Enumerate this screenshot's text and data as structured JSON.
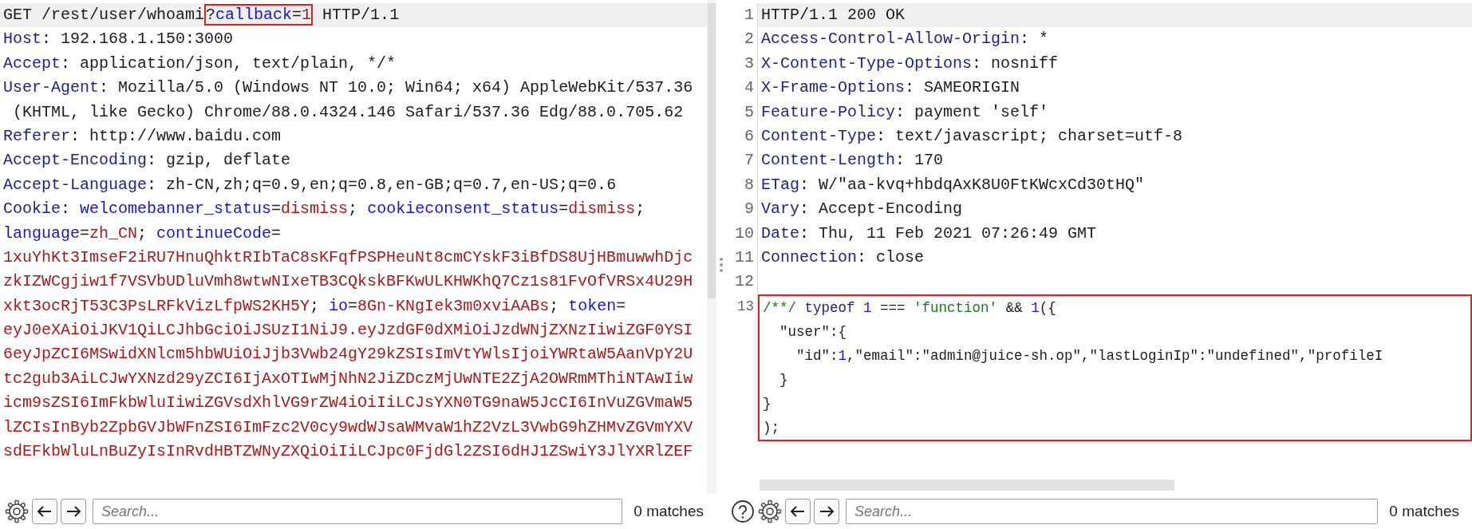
{
  "request": {
    "lines": [
      {
        "current": true,
        "segments": [
          {
            "text": "GET /rest/user/whoami",
            "kind": "plain"
          }
        ],
        "box": [
          {
            "text": "?",
            "kind": "plain"
          },
          {
            "text": "callback",
            "kind": "param"
          },
          {
            "text": "=",
            "kind": "plain"
          },
          {
            "text": "1",
            "kind": "value"
          }
        ],
        "after": [
          {
            "text": " HTTP/1.1",
            "kind": "plain"
          }
        ]
      },
      {
        "current": false,
        "segments": [
          {
            "text": "Host",
            "kind": "key"
          },
          {
            "text": ": 192.168.1.150:3000",
            "kind": "plain"
          }
        ]
      },
      {
        "current": false,
        "segments": [
          {
            "text": "Accept",
            "kind": "key"
          },
          {
            "text": ": application/json, text/plain, */*",
            "kind": "plain"
          }
        ]
      },
      {
        "current": false,
        "segments": [
          {
            "text": "User-Agent",
            "kind": "key"
          },
          {
            "text": ": Mozilla/5.0 (Windows NT 10.0; Win64; x64) AppleWebKit/537.36",
            "kind": "plain"
          }
        ]
      },
      {
        "current": false,
        "segments": [
          {
            "text": " (KHTML, like Gecko) Chrome/88.0.4324.146 Safari/537.36 Edg/88.0.705.62",
            "kind": "plain"
          }
        ]
      },
      {
        "current": false,
        "segments": [
          {
            "text": "Referer",
            "kind": "key"
          },
          {
            "text": ": http://www.baidu.com",
            "kind": "plain"
          }
        ]
      },
      {
        "current": false,
        "segments": [
          {
            "text": "Accept-Encoding",
            "kind": "key"
          },
          {
            "text": ": gzip, deflate",
            "kind": "plain"
          }
        ]
      },
      {
        "current": false,
        "segments": [
          {
            "text": "Accept-Language",
            "kind": "key"
          },
          {
            "text": ": zh-CN,zh;q=0.9,en;q=0.8,en-GB;q=0.7,en-US;q=0.6",
            "kind": "plain"
          }
        ]
      },
      {
        "current": false,
        "segments": [
          {
            "text": "Cookie",
            "kind": "key"
          },
          {
            "text": ": ",
            "kind": "plain"
          },
          {
            "text": "welcomebanner_status",
            "kind": "param"
          },
          {
            "text": "=",
            "kind": "plain"
          },
          {
            "text": "dismiss",
            "kind": "value"
          },
          {
            "text": "; ",
            "kind": "plain"
          },
          {
            "text": "cookieconsent_status",
            "kind": "param"
          },
          {
            "text": "=",
            "kind": "plain"
          },
          {
            "text": "dismiss",
            "kind": "value"
          },
          {
            "text": ";",
            "kind": "plain"
          }
        ]
      },
      {
        "current": false,
        "segments": [
          {
            "text": "language",
            "kind": "param"
          },
          {
            "text": "=",
            "kind": "plain"
          },
          {
            "text": "zh_CN",
            "kind": "value"
          },
          {
            "text": "; ",
            "kind": "plain"
          },
          {
            "text": "continueCode",
            "kind": "param"
          },
          {
            "text": "=",
            "kind": "plain"
          }
        ]
      },
      {
        "current": false,
        "segments": [
          {
            "text": "1xuYhKt3ImseF2iRU7HnuQhktRIbTaC8sKFqfPSPHeuNt8cmCYskF3iBfDS8UjHBmuwwhDjc",
            "kind": "value"
          }
        ]
      },
      {
        "current": false,
        "segments": [
          {
            "text": "zkIZWCgjiw1f7VSVbUDluVmh8wtwNIxeTB3CQkskBFKwULKHWKhQ7Cz1s81FvOfVRSx4U29H",
            "kind": "value"
          }
        ]
      },
      {
        "current": false,
        "segments": [
          {
            "text": "xkt3ocRjT53C3PsLRFkVizLfpWS2KH5Y",
            "kind": "value"
          },
          {
            "text": "; ",
            "kind": "plain"
          },
          {
            "text": "io",
            "kind": "param"
          },
          {
            "text": "=",
            "kind": "plain"
          },
          {
            "text": "8Gn-KNgIek3m0xviAABs",
            "kind": "value"
          },
          {
            "text": "; ",
            "kind": "plain"
          },
          {
            "text": "token",
            "kind": "param"
          },
          {
            "text": "=",
            "kind": "plain"
          }
        ]
      },
      {
        "current": false,
        "segments": [
          {
            "text": "eyJ0eXAiOiJKV1QiLCJhbGciOiJSUzI1NiJ9.eyJzdGF0dXMiOiJzdWNjZXNzIiwiZGF0YSI",
            "kind": "value"
          }
        ]
      },
      {
        "current": false,
        "segments": [
          {
            "text": "6eyJpZCI6MSwidXNlcm5hbWUiOiJjb3Vwb24gY29kZSIsImVtYWlsIjoiYWRtaW5AanVpY2U",
            "kind": "value"
          }
        ]
      },
      {
        "current": false,
        "segments": [
          {
            "text": "tc2gub3AiLCJwYXNzd29yZCI6IjAxOTIwMjNhN2JiZDczMjUwNTE2ZjA2OWRmMThiNTAwIiw",
            "kind": "value"
          }
        ]
      },
      {
        "current": false,
        "segments": [
          {
            "text": "icm9sZSI6ImFkbWluIiwiZGVsdXhlVG9rZW4iOiIiLCJsYXN0TG9naW5JcCI6InVuZGVmaW5",
            "kind": "value"
          }
        ]
      },
      {
        "current": false,
        "segments": [
          {
            "text": "lZCIsInByb2ZpbGVJbWFnZSI6ImFzc2V0cy9wdWJsaWMvaW1hZ2VzL3VwbG9hZHMvZGVmYXV",
            "kind": "value"
          }
        ]
      },
      {
        "current": false,
        "segments": [
          {
            "text": "sdEFkbWluLnBuZyIsInRvdHBTZWNyZXQiOiIiLCJpc0FjdGl2ZSI6dHJ1ZSwiY3JlYXRlZEF",
            "kind": "value"
          }
        ]
      }
    ],
    "footer": {
      "help_button": false,
      "search": {
        "placeholder": "Search..."
      },
      "matches": "0 matches"
    }
  },
  "response": {
    "lines": [
      {
        "number": "1",
        "current": true,
        "segments": [
          {
            "text": "HTTP/1.1 200 OK",
            "kind": "plain"
          }
        ]
      },
      {
        "number": "2",
        "current": false,
        "segments": [
          {
            "text": "Access-Control-Allow-Origin",
            "kind": "key"
          },
          {
            "text": ": *",
            "kind": "plain"
          }
        ]
      },
      {
        "number": "3",
        "current": false,
        "segments": [
          {
            "text": "X-Content-Type-Options",
            "kind": "key"
          },
          {
            "text": ": nosniff",
            "kind": "plain"
          }
        ]
      },
      {
        "number": "4",
        "current": false,
        "segments": [
          {
            "text": "X-Frame-Options",
            "kind": "key"
          },
          {
            "text": ": SAMEORIGIN",
            "kind": "plain"
          }
        ]
      },
      {
        "number": "5",
        "current": false,
        "segments": [
          {
            "text": "Feature-Policy",
            "kind": "key"
          },
          {
            "text": ": payment 'self'",
            "kind": "plain"
          }
        ]
      },
      {
        "number": "6",
        "current": false,
        "segments": [
          {
            "text": "Content-Type",
            "kind": "key"
          },
          {
            "text": ": text/javascript; charset=utf-8",
            "kind": "plain"
          }
        ]
      },
      {
        "number": "7",
        "current": false,
        "segments": [
          {
            "text": "Content-Length",
            "kind": "key"
          },
          {
            "text": ": 170",
            "kind": "plain"
          }
        ]
      },
      {
        "number": "8",
        "current": false,
        "segments": [
          {
            "text": "ETag",
            "kind": "key"
          },
          {
            "text": ": W/\"aa-kvq+hbdqAxK8U0FtKWcxCd30tHQ\"",
            "kind": "plain"
          }
        ]
      },
      {
        "number": "9",
        "current": false,
        "segments": [
          {
            "text": "Vary",
            "kind": "key"
          },
          {
            "text": ": Accept-Encoding",
            "kind": "plain"
          }
        ]
      },
      {
        "number": "10",
        "current": false,
        "segments": [
          {
            "text": "Date",
            "kind": "key"
          },
          {
            "text": ": Thu, 11 Feb 2021 07:26:49 GMT",
            "kind": "plain"
          }
        ]
      },
      {
        "number": "11",
        "current": false,
        "segments": [
          {
            "text": "Connection",
            "kind": "key"
          },
          {
            "text": ": close",
            "kind": "plain"
          }
        ]
      },
      {
        "number": "12",
        "current": false
      }
    ],
    "boxed_line": {
      "number": "13",
      "rows": [
        [
          {
            "text": "/**/",
            "kind": "comment"
          },
          {
            "text": " ",
            "kind": "plain"
          },
          {
            "text": "typeof",
            "kind": "keyword"
          },
          {
            "text": " ",
            "kind": "plain"
          },
          {
            "text": "1",
            "kind": "number"
          },
          {
            "text": " === ",
            "kind": "plain"
          },
          {
            "text": "'function'",
            "kind": "string"
          },
          {
            "text": " && ",
            "kind": "plain"
          },
          {
            "text": "1",
            "kind": "number"
          },
          {
            "text": "({",
            "kind": "plain"
          }
        ],
        [
          {
            "text": "  \"user\":{",
            "kind": "plain"
          }
        ],
        [
          {
            "text": "    \"id\":",
            "kind": "plain"
          },
          {
            "text": "1",
            "kind": "number"
          },
          {
            "text": ",\"email\":\"admin@juice-sh.op\",\"lastLoginIp\":\"undefined\",\"profileI",
            "kind": "plain"
          }
        ],
        [
          {
            "text": "  }",
            "kind": "plain"
          }
        ],
        [
          {
            "text": "}",
            "kind": "plain"
          }
        ],
        [
          {
            "text": ");",
            "kind": "plain"
          }
        ]
      ]
    },
    "footer": {
      "help_button": true,
      "search": {
        "placeholder": "Search..."
      },
      "matches": "0 matches"
    }
  }
}
